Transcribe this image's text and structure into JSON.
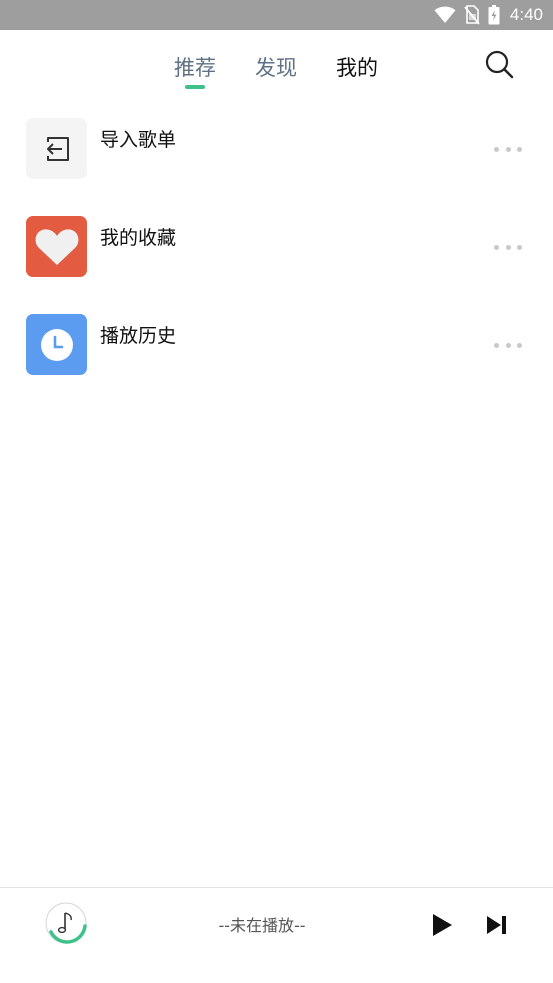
{
  "status_bar": {
    "time": "4:40",
    "icons": [
      "wifi-icon",
      "no-sim-icon",
      "battery-charging-icon"
    ]
  },
  "tabs": [
    {
      "label": "推荐",
      "state": "selected"
    },
    {
      "label": "发现",
      "state": "normal"
    },
    {
      "label": "我的",
      "state": "current"
    }
  ],
  "header": {
    "search_icon": "search-icon"
  },
  "list": [
    {
      "label": "导入歌单",
      "icon": "import-icon",
      "icon_bg": "#f4f4f4"
    },
    {
      "label": "我的收藏",
      "icon": "heart-icon",
      "icon_bg": "#e35b40"
    },
    {
      "label": "播放历史",
      "icon": "clock-icon",
      "icon_bg": "#5b9bf0"
    }
  ],
  "player": {
    "status": "--未在播放--",
    "icons": [
      "music-note-icon",
      "play-icon",
      "skip-next-icon"
    ]
  },
  "colors": {
    "accent": "#3ec18b",
    "status_bar": "#9e9e9e",
    "tab_inactive": "#5f7184"
  }
}
